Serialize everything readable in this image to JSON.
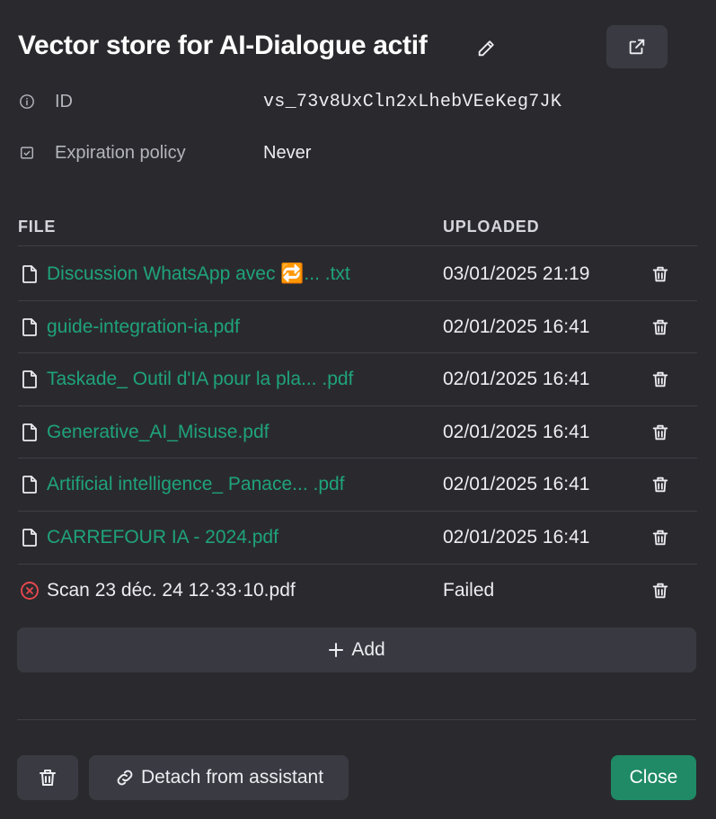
{
  "header": {
    "title": "Vector store for AI-Dialogue actif",
    "edit_icon": "pencil-icon",
    "open_icon": "external-link-icon"
  },
  "meta": {
    "id_label": "ID",
    "id_value": "vs_73v8UxCln2xLhebVEeKeg7JK",
    "expiration_label": "Expiration policy",
    "expiration_value": "Never"
  },
  "table": {
    "col_file": "FILE",
    "col_uploaded": "UPLOADED",
    "rows": [
      {
        "name": "Discussion WhatsApp avec 🔁... .txt",
        "uploaded": "03/01/2025 21:19",
        "status": "ok"
      },
      {
        "name": "guide-integration-ia.pdf",
        "uploaded": "02/01/2025 16:41",
        "status": "ok"
      },
      {
        "name": "Taskade_ Outil d'IA pour la pla... .pdf",
        "uploaded": "02/01/2025 16:41",
        "status": "ok"
      },
      {
        "name": "Generative_AI_Misuse.pdf",
        "uploaded": "02/01/2025 16:41",
        "status": "ok"
      },
      {
        "name": "Artificial intelligence_ Panace... .pdf",
        "uploaded": "02/01/2025 16:41",
        "status": "ok"
      },
      {
        "name": "CARREFOUR IA - 2024.pdf",
        "uploaded": "02/01/2025 16:41",
        "status": "ok"
      },
      {
        "name": "Scan 23 déc. 24 12·33·10.pdf",
        "uploaded": "Failed",
        "status": "failed"
      }
    ]
  },
  "actions": {
    "add_label": "Add",
    "detach_label": "Detach from assistant",
    "close_label": "Close"
  },
  "colors": {
    "background": "#2a2a2e",
    "link_green": "#1fa37a",
    "primary_button": "#1f8a65",
    "error_red": "#e5484d"
  }
}
